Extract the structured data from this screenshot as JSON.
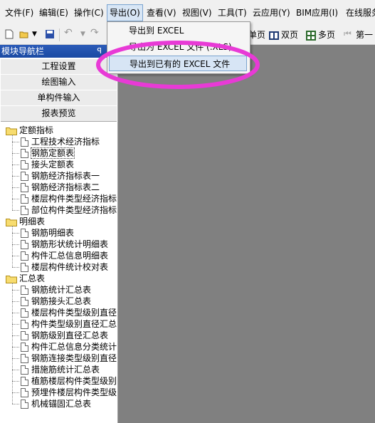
{
  "menubar": {
    "items": [
      "文件(F)",
      "编辑(E)",
      "操作(C)",
      "导出(O)",
      "查看(V)",
      "视图(V)",
      "工具(T)",
      "云应用(Y)",
      "BIM应用(I)",
      "在线服务"
    ]
  },
  "export_menu": {
    "items": [
      "导出到 EXCEL",
      "导出为 EXCEL 文件 (.XLS)",
      "导出到已有的 EXCEL 文件"
    ]
  },
  "toolbar": {
    "single_page": "单页",
    "double_page": "双页",
    "multi_page": "多页",
    "first_page": "第一"
  },
  "panel": {
    "title": "模块导航栏",
    "pin": "ᅟ",
    "buttons": [
      "工程设置",
      "绘图输入",
      "单构件输入",
      "报表预览"
    ]
  },
  "tree": {
    "groups": [
      {
        "label": "定额指标",
        "items": [
          "工程技术经济指标",
          "钢筋定额表",
          "接头定额表",
          "钢筋经济指标表一",
          "钢筋经济指标表二",
          "楼层构件类型经济指标",
          "部位构件类型经济指标"
        ]
      },
      {
        "label": "明细表",
        "items": [
          "钢筋明细表",
          "钢筋形状统计明细表",
          "构件汇总信息明细表",
          "楼层构件统计校对表"
        ]
      },
      {
        "label": "汇总表",
        "items": [
          "钢筋统计汇总表",
          "钢筋接头汇总表",
          "楼层构件类型级别直径",
          "构件类型级别直径汇总",
          "钢筋级别直径汇总表",
          "构件汇总信息分类统计",
          "钢筋连接类型级别直径",
          "措施筋统计汇总表",
          "植筋楼层构件类型级别",
          "预埋件楼层构件类型级",
          "机械锚固汇总表"
        ]
      }
    ]
  },
  "colors": {
    "workspace": "#808080",
    "annotation": "#e83ad6",
    "panel_title": "#1a4aa3"
  }
}
